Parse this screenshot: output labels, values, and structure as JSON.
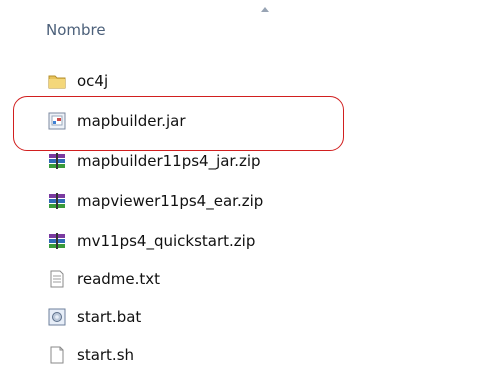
{
  "header": {
    "column_name": "Nombre"
  },
  "files": [
    {
      "name": "oc4j",
      "icon": "folder-icon"
    },
    {
      "name": "mapbuilder.jar",
      "icon": "jar-file-icon"
    },
    {
      "name": "mapbuilder11ps4_jar.zip",
      "icon": "winrar-archive-icon"
    },
    {
      "name": "mapviewer11ps4_ear.zip",
      "icon": "winrar-archive-icon"
    },
    {
      "name": "mv11ps4_quickstart.zip",
      "icon": "winrar-archive-icon"
    },
    {
      "name": "readme.txt",
      "icon": "text-file-icon"
    },
    {
      "name": "start.bat",
      "icon": "batch-file-icon"
    },
    {
      "name": "start.sh",
      "icon": "blank-file-icon"
    }
  ],
  "colors": {
    "header_text": "#4c607a",
    "highlight_border": "#d11f1f"
  }
}
